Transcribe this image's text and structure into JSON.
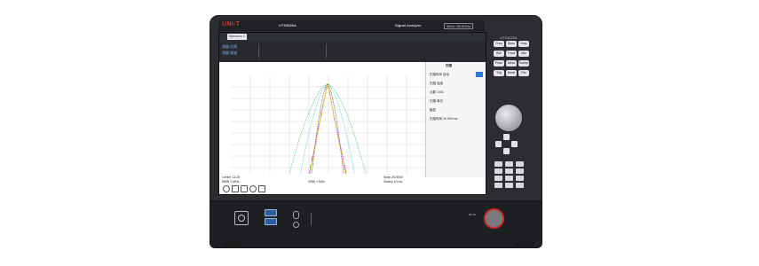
{
  "instrument": {
    "brand": "UNI-T",
    "model": "UTS3026A",
    "type_label": "Signal Analyzer",
    "freq_range": "9kHz~26.5GHz",
    "keypad_header": "UTS3026A"
  },
  "screen": {
    "tab_label": "Spectrum 1",
    "info_left": [
      "测量:扫频",
      "测量:频谱"
    ],
    "side_panel": {
      "title": "扫描",
      "items": [
        "扫描时间 自动",
        "扫描 连续",
        "点数 1001",
        "扫描 单次",
        "触发",
        "扫描时间 10.000 ms"
      ]
    },
    "status_left": [
      "Center 13.25",
      "RBW 1 MHz"
    ],
    "status_mid": "VBW 1 MHz",
    "status_right": [
      "Span 26.5000",
      "Sweep 10 ms"
    ]
  },
  "keys": {
    "top": [
      "Freq",
      "Span",
      "Amp",
      "BW",
      "Trace",
      "Mkr",
      "Peak",
      "Meas",
      "Sweep",
      "Trig",
      "Mode",
      "File"
    ],
    "numpad": [
      "7",
      "8",
      "9",
      "4",
      "5",
      "6",
      "1",
      "2",
      "3",
      "0",
      ".",
      "-"
    ]
  },
  "colors": {
    "body": "#2b2d31",
    "trace_yellow": "#e8e33a",
    "trace_magenta": "#d62be0",
    "trace_green": "#2fcf4a",
    "trace_cyan": "#46c8d8",
    "rf_ring": "#cf2f24",
    "usb": "#2f5ea0"
  },
  "icons": [
    "power-icon",
    "usb-icon",
    "headphone-icon",
    "rf-input-icon",
    "knob-icon",
    "arrow-keys-icon"
  ]
}
